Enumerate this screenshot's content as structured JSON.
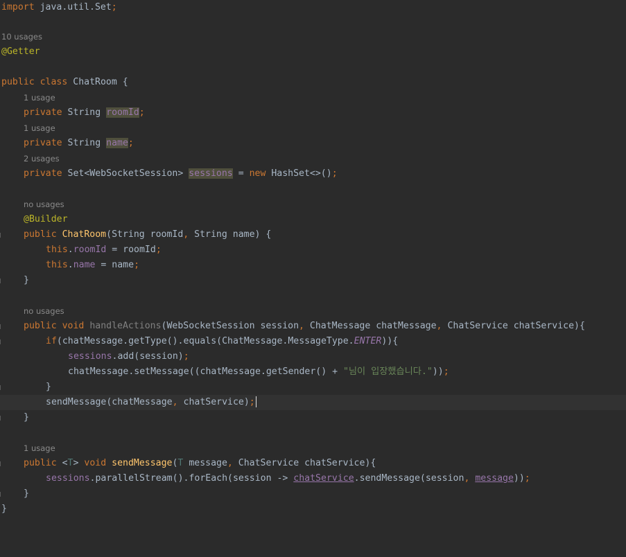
{
  "hints": {
    "class_usages": "10 usages",
    "roomId_usages": "1 usage",
    "name_usages": "1 usage",
    "sessions_usages": "2 usages",
    "ctor_usages": "no usages",
    "handle_usages": "no usages",
    "send_usages": "1 usage"
  },
  "code": {
    "import_kw": "import",
    "import_path": " java.util.Set",
    "semicolon": ";",
    "ann_getter": "@Getter",
    "public": "public",
    "class_kw": "class",
    "class_name": "ChatRoom",
    "open_brace": " {",
    "close_brace": "}",
    "private": "private",
    "string_type": "String",
    "roomId": "roomId",
    "name": "name",
    "set_type": "Set<WebSocketSession>",
    "sessions": "sessions",
    "assign": " = ",
    "new_kw": "new",
    "hashset": " HashSet<>()",
    "ann_builder": "@Builder",
    "ctor_name": "ChatRoom",
    "ctor_params_1": "(String roomId",
    "comma": ", ",
    "ctor_params_2": "String name) {",
    "this_kw": "this",
    "dot": ".",
    "assign_roomId": " = roomId",
    "assign_name": " = name",
    "void_kw": "void",
    "handle_name": "handleActions",
    "handle_p1": "(WebSocketSession session",
    "handle_p2": "ChatMessage chatMessage",
    "handle_p3": "ChatService chatService){",
    "if_kw": "if",
    "if_cond_1": "(chatMessage.getType().equals(ChatMessage.MessageType.",
    "enter": "ENTER",
    "if_cond_2": ")){",
    "sessions_add": ".add(session)",
    "set_msg_1": "chatMessage.setMessage((chatMessage.getSender() + ",
    "korean_str": "\"님이 입장했습니다.\"",
    "set_msg_2": "))",
    "send_call_1": "sendMessage(chatMessage",
    "send_call_2": "chatService)",
    "generic_open": "<",
    "t_param": "T",
    "generic_close": ">",
    "send_name": "sendMessage",
    "send_params_1": "(",
    "send_params_2": " message",
    "send_params_3": "ChatService chatService){",
    "stream_1": ".parallelStream().forEach(session -> ",
    "chat_service": "chatService",
    "stream_2": ".sendMessage(session",
    "message": "message",
    "stream_3": "))"
  }
}
